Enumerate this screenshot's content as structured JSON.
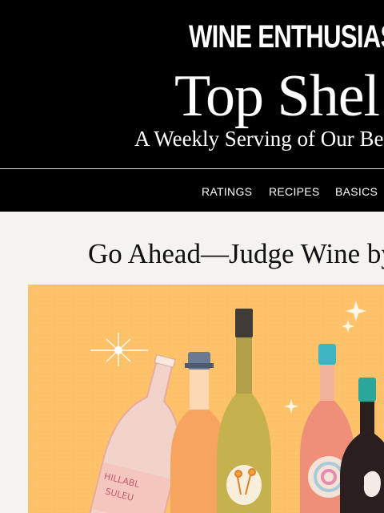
{
  "header": {
    "brand": "WINE ENTHUSIAST",
    "title": "Top Shel",
    "subtitle": "A Weekly Serving of Our Bes"
  },
  "nav": {
    "items": [
      {
        "label": "RATINGS"
      },
      {
        "label": "RECIPES"
      },
      {
        "label": "BASICS"
      }
    ]
  },
  "article": {
    "headline": "Go Ahead—Judge Wine by",
    "hero_image": {
      "label_text_1": "HILLABL",
      "label_text_2": "SULEU",
      "background_color": "#fdc26a"
    }
  }
}
